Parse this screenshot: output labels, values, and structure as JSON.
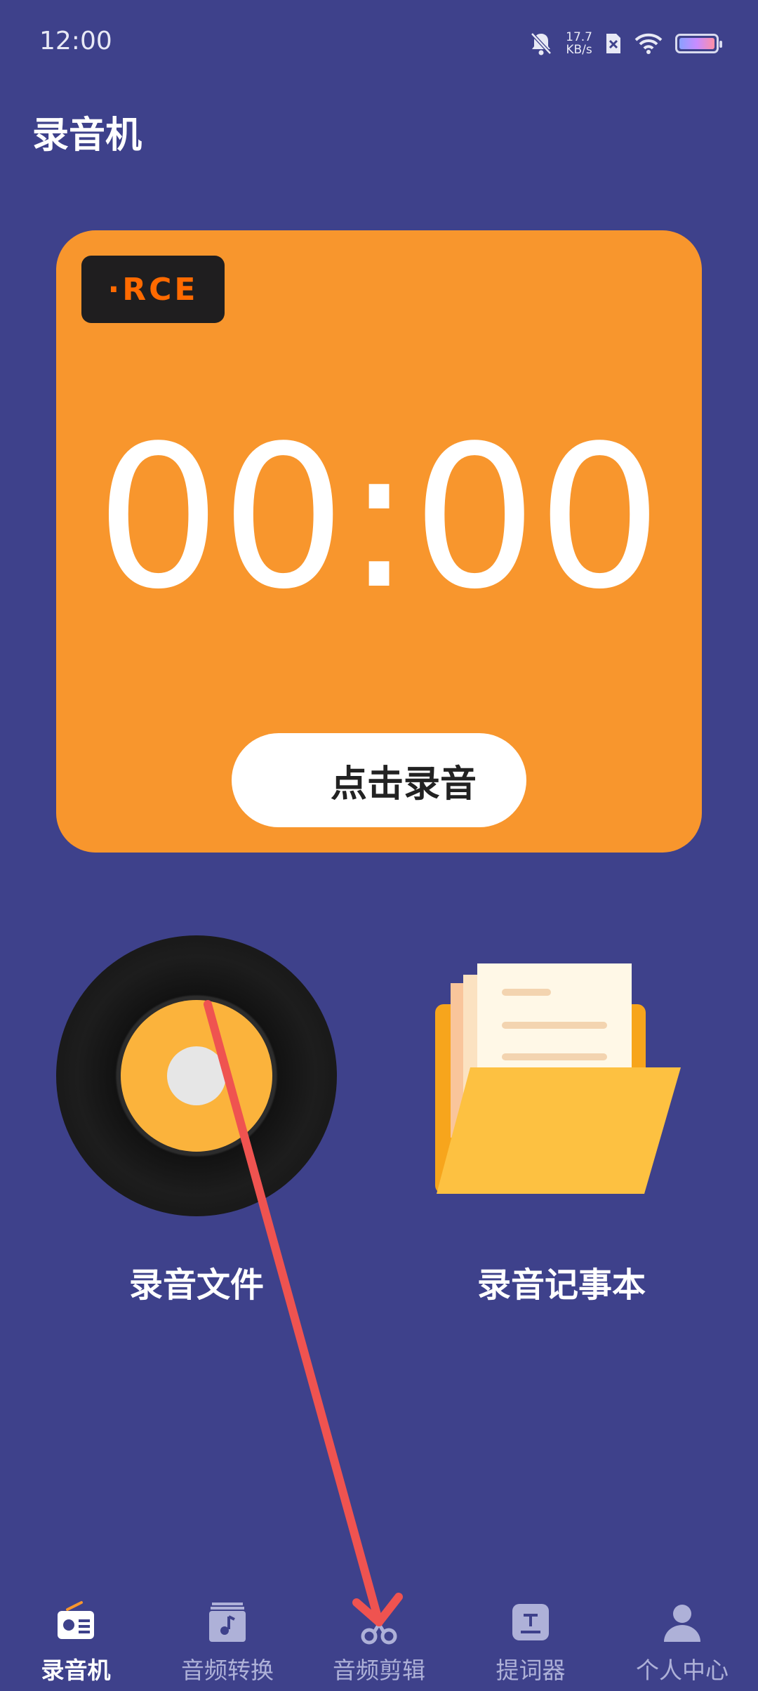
{
  "status_bar": {
    "time": "12:00",
    "net_speed_value": "17.7",
    "net_speed_unit": "KB/s",
    "battery_level": 1.0,
    "icons": [
      "bell-mute-icon",
      "sim-icon",
      "wifi-icon",
      "battery-icon"
    ]
  },
  "page": {
    "title": "录音机"
  },
  "recorder": {
    "badge": "·RCE",
    "timer": "00:00",
    "record_button": "点击录音",
    "card_color": "#f8962d"
  },
  "features": [
    {
      "label": "录音文件",
      "icon": "vinyl-record-icon"
    },
    {
      "label": "录音记事本",
      "icon": "folder-notes-icon"
    }
  ],
  "bottom_nav": [
    {
      "label": "录音机",
      "icon": "radio-icon",
      "active": true
    },
    {
      "label": "音频转换",
      "icon": "music-note-icon",
      "active": false
    },
    {
      "label": "音频剪辑",
      "icon": "scissors-icon",
      "active": false
    },
    {
      "label": "提词器",
      "icon": "teleprompter-icon",
      "active": false
    },
    {
      "label": "个人中心",
      "icon": "profile-icon",
      "active": false
    }
  ],
  "colors": {
    "background": "#3e418b",
    "accent": "#f8962d",
    "annotation_arrow": "#ef5350"
  }
}
